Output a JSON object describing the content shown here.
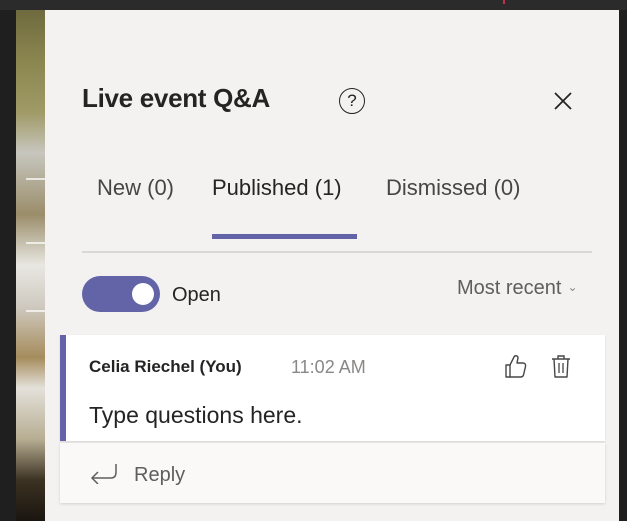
{
  "panel": {
    "title": "Live event Q&A",
    "help_glyph": "?",
    "help_icon": "question-circle-icon",
    "close_icon": "close-icon"
  },
  "tabs": [
    {
      "label": "New (0)",
      "active": false
    },
    {
      "label": "Published (1)",
      "active": true
    },
    {
      "label": "Dismissed (0)",
      "active": false
    }
  ],
  "filter": {
    "toggle_on": true,
    "toggle_label": "Open",
    "sort_label": "Most recent",
    "sort_icon": "chevron-down-icon"
  },
  "question": {
    "author": "Celia Riechel (You)",
    "time": "11:02 AM",
    "text": "Type questions here.",
    "like_icon": "thumbs-up-icon",
    "delete_icon": "trash-icon"
  },
  "reply": {
    "label": "Reply",
    "icon": "reply-arrow-icon"
  },
  "colors": {
    "accent": "#6264a7",
    "panel_bg": "#f3f2f1",
    "text": "#252423",
    "muted": "#8a8886"
  }
}
